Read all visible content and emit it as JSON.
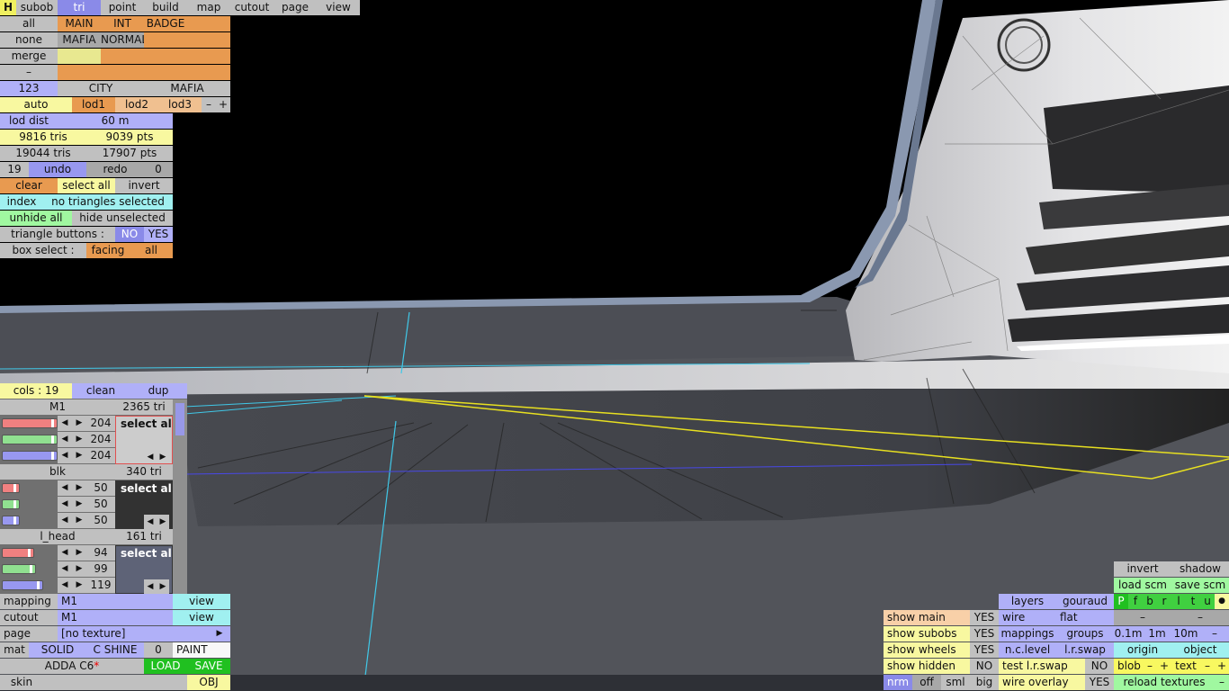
{
  "colors": {
    "lav": "#b0b0f8",
    "blue": "#9898f0",
    "gray": "#c0c0c0",
    "dgray": "#a8a8a8",
    "orange": "#e89a50",
    "yellow": "#f8f8a0",
    "cyan": "#a0f0f0",
    "green": "#20c020",
    "lgreen": "#a0f8a0",
    "white": "#f8f8f8"
  },
  "toptabs": [
    "H",
    "subob",
    "tri",
    "point",
    "build",
    "map",
    "cutout",
    "page",
    "view"
  ],
  "sel": {
    "all": "all",
    "none": "none",
    "merge": "merge",
    "dash": "–",
    "main": "MAIN",
    "int": "INT",
    "badge": "BADGE",
    "mafia": "MAFIA",
    "normal": "NORMAL"
  },
  "lod": {
    "n123": "123",
    "city": "CITY",
    "mafia": "MAFIA",
    "auto": "auto",
    "lod1": "lod1",
    "lod2": "lod2",
    "lod3": "lod3",
    "minus": "–",
    "plus": "+",
    "dist_label": "lod dist",
    "dist_value": "60 m"
  },
  "stats": {
    "tris1": "9816 tris",
    "pts1": "9039 pts",
    "tris2": "19044 tris",
    "pts2": "17907 pts",
    "undo_count": "19",
    "undo": "undo",
    "redo": "redo",
    "redo_count": "0"
  },
  "tri_actions": {
    "clear": "clear",
    "select_all": "select all",
    "invert": "invert",
    "index": "index",
    "no_sel": "no triangles selected",
    "unhide_all": "unhide all",
    "hide_unsel": "hide unselected",
    "tri_buttons": "triangle buttons :",
    "no": "NO",
    "yes": "YES",
    "box_select": "box select :",
    "facing": "facing",
    "all": "all"
  },
  "mat_header": {
    "cols": "cols : 19",
    "clean": "clean",
    "dup": "dup"
  },
  "materials": [
    {
      "name": "M1",
      "tris": "2365 tri",
      "r": "204",
      "g": "204",
      "b": "204",
      "select": "select all"
    },
    {
      "name": "blk",
      "tris": "340 tri",
      "r": "50",
      "g": "50",
      "b": "50",
      "select": "select all"
    },
    {
      "name": "l_head",
      "tris": "161 tri",
      "r": "94",
      "g": "99",
      "b": "119",
      "select": "select all"
    }
  ],
  "arrows": {
    "left": "◀",
    "right": "▶"
  },
  "bottom_left": {
    "mapping": "mapping",
    "mapping_val": "M1",
    "cutout": "cutout",
    "cutout_val": "M1",
    "view": "view",
    "page": "page",
    "page_val": "[no texture]",
    "page_arrow": "▶",
    "mat": "mat",
    "solid": "SOLID",
    "cshine": "C SHINE",
    "zero": "0",
    "paint": "PAINT",
    "model": "ADDA C6",
    "star": "*",
    "load": "LOAD",
    "save": "SAVE",
    "skin": "skin",
    "obj": "OBJ"
  },
  "br": {
    "invert": "invert",
    "shadow": "shadow",
    "load_scm": "load scm",
    "save_scm": "save scm",
    "layers": "layers",
    "gouraud": "gouraud",
    "pfbrltu": [
      "P",
      "f",
      "b",
      "r",
      "l",
      "t",
      "u"
    ],
    "dot": "●",
    "wire": "wire",
    "flat": "flat",
    "dash": "–",
    "mappings": "mappings",
    "groups": "groups",
    "d01": "0.1m",
    "d1": "1m",
    "d10": "10m",
    "n_c_level": "n.c.level",
    "lr_swap": "l.r.swap",
    "origin": "origin",
    "object": "object",
    "test_lr": "test l.r.swap",
    "no": "NO",
    "blob": "blob",
    "minus": "–",
    "plus": "+",
    "text": "text",
    "wire_overlay": "wire overlay",
    "yes": "YES",
    "reload": "reload textures",
    "show_main": "show main",
    "show_subobs": "show subobs",
    "show_wheels": "show wheels",
    "show_hidden": "show hidden",
    "nrm": "nrm",
    "off": "off",
    "sml": "sml",
    "big": "big"
  }
}
